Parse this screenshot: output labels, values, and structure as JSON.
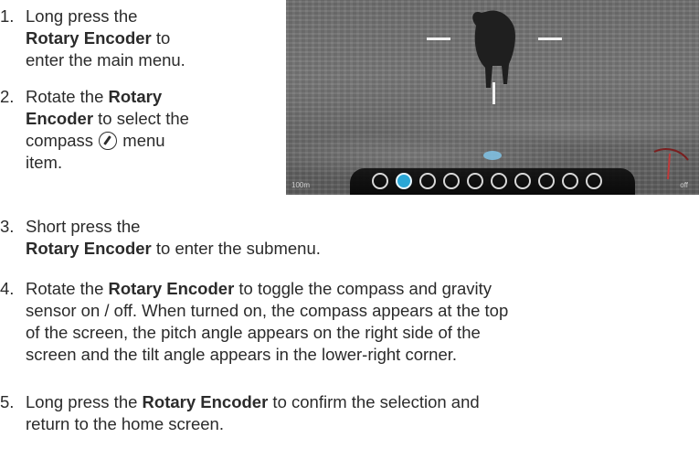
{
  "steps": [
    {
      "number": "1.",
      "line1": "Long press the",
      "line2_bold": "Rotary Encoder",
      "line2_rest": " to",
      "line3": "enter the main menu."
    },
    {
      "number": "2.",
      "line1_pre": "Rotate the ",
      "line1_bold": "Rotary",
      "line2_bold": "Encoder",
      "line2_rest": " to select the",
      "line3_pre": "compass ",
      "line3_post": " menu",
      "line4": "item."
    },
    {
      "number": "3.",
      "line1": "Short press the",
      "line2_bold": "Rotary Encoder",
      "line2_rest": " to enter the submenu."
    },
    {
      "number": "4.",
      "line1_pre": "Rotate the ",
      "line1_bold": "Rotary Encoder",
      "line1_rest": " to toggle the compass and gravity",
      "line2": "sensor on / off. When turned on, the compass appears at the top",
      "line3": "of the screen, the pitch angle appears on the right side of the",
      "line4": "screen and the tilt angle appears in the lower-right corner."
    },
    {
      "number": "5.",
      "line1_pre": "Long press the ",
      "line1_bold": "Rotary Encoder",
      "line1_rest": " to confirm the selection and",
      "line2": "return to the home screen."
    }
  ],
  "scope": {
    "bottom_left_label": "100m",
    "bottom_right_label": "off",
    "menu_icons": [
      "wifi-icon",
      "compass-icon",
      "microphone-icon",
      "moon-icon",
      "home-icon",
      "photo-icon",
      "reticle-icon",
      "crosshair-icon",
      "image-icon",
      "settings-icon"
    ],
    "active_icon": "compass-icon"
  }
}
